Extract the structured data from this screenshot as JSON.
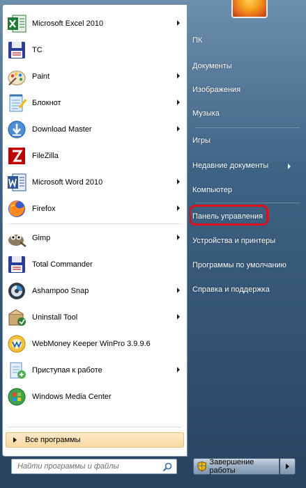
{
  "programs": [
    {
      "label": "Microsoft Excel 2010",
      "icon": "excel-icon",
      "submenu": true
    },
    {
      "label": "TC",
      "icon": "floppy-icon",
      "submenu": false
    },
    {
      "label": "Paint",
      "icon": "paint-icon",
      "submenu": true
    },
    {
      "label": "Блокнот",
      "icon": "notepad-icon",
      "submenu": true
    },
    {
      "label": "Download Master",
      "icon": "download-master-icon",
      "submenu": true
    },
    {
      "label": "FileZilla",
      "icon": "filezilla-icon",
      "submenu": false
    },
    {
      "label": "Microsoft Word 2010",
      "icon": "word-icon",
      "submenu": true
    },
    {
      "label": "Firefox",
      "icon": "firefox-icon",
      "submenu": true
    },
    {
      "label": "Gimp",
      "icon": "gimp-icon",
      "submenu": true
    },
    {
      "label": "Total Commander",
      "icon": "floppy-icon",
      "submenu": false
    },
    {
      "label": "Ashampoo Snap",
      "icon": "ashampoo-snap-icon",
      "submenu": true
    },
    {
      "label": "Uninstall Tool",
      "icon": "uninstall-tool-icon",
      "submenu": true
    },
    {
      "label": "WebMoney Keeper WinPro 3.9.9.6",
      "icon": "webmoney-icon",
      "submenu": false
    },
    {
      "label": "Приступая к работе",
      "icon": "getting-started-icon",
      "submenu": true
    },
    {
      "label": "Windows Media Center",
      "icon": "media-center-icon",
      "submenu": false
    }
  ],
  "all_programs_label": "Все программы",
  "search": {
    "placeholder": "Найти программы и файлы"
  },
  "right": {
    "items": [
      {
        "label": "ПК"
      },
      {
        "label": "Документы"
      },
      {
        "label": "Изображения"
      },
      {
        "label": "Музыка"
      },
      {
        "label": "Игры"
      },
      {
        "label": "Недавние документы"
      },
      {
        "label": "Компьютер"
      },
      {
        "label": "Панель управления"
      },
      {
        "label": "Устройства и принтеры"
      },
      {
        "label": "Программы по умолчанию"
      },
      {
        "label": "Справка и поддержка"
      }
    ]
  },
  "shutdown_label": "Завершение работы",
  "colors": {
    "highlight": "#e0101a",
    "accent": "#f9d9a3"
  }
}
